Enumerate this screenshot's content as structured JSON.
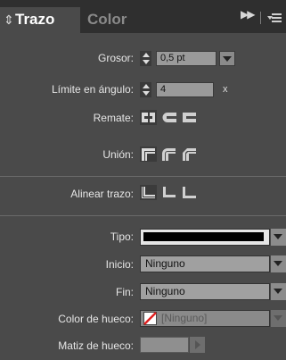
{
  "panel": {
    "tabs": [
      {
        "label": "Trazo",
        "active": true
      },
      {
        "label": "Color",
        "active": false
      }
    ],
    "icons": {
      "collapse": "double-chevron-up-down-icon",
      "expand": "double-arrow-right-icon",
      "menu": "panel-menu-icon"
    }
  },
  "stroke": {
    "weight_label": "Grosor:",
    "weight_value": "0,5 pt",
    "miter_label": "Límite en ángulo:",
    "miter_value": "4",
    "miter_unit": "x",
    "cap_label": "Remate:",
    "caps": [
      "butt-cap-icon",
      "round-cap-icon",
      "projecting-cap-icon"
    ],
    "join_label": "Unión:",
    "joins": [
      "miter-join-icon",
      "round-join-icon",
      "bevel-join-icon"
    ],
    "align_label": "Alinear trazo:",
    "aligns": [
      "align-center-icon",
      "align-inside-icon",
      "align-outside-icon"
    ]
  },
  "style": {
    "type_label": "Tipo:",
    "start_label": "Inicio:",
    "start_value": "Ninguno",
    "end_label": "Fin:",
    "end_value": "Ninguno",
    "gap_color_label": "Color de hueco:",
    "gap_color_value": "[Ninguno]",
    "gap_tint_label": "Matiz de hueco:"
  }
}
